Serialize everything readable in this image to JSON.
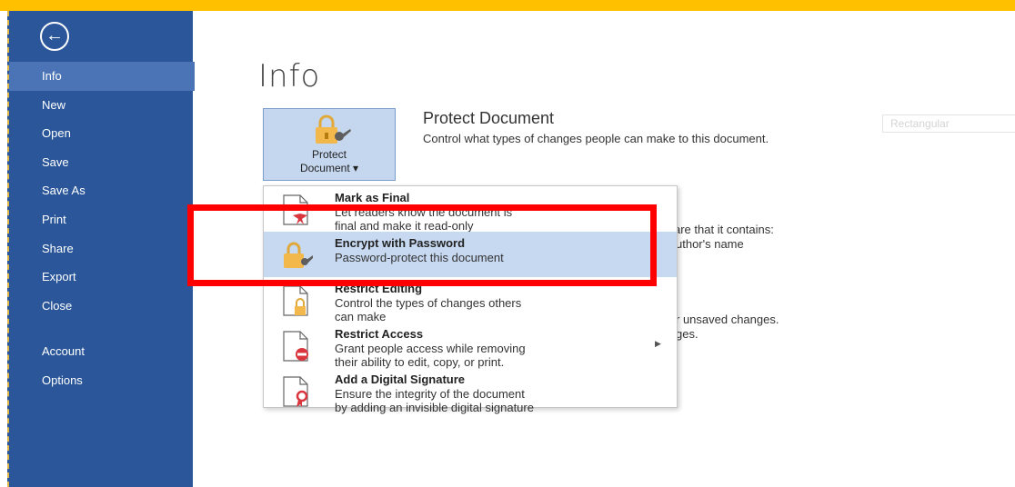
{
  "nav": {
    "back_label": "←",
    "items": [
      "Info",
      "New",
      "Open",
      "Save",
      "Save As",
      "Print",
      "Share",
      "Export",
      "Close"
    ],
    "bottom_items": [
      "Account",
      "Options"
    ]
  },
  "page": {
    "title": "Info"
  },
  "protect": {
    "button_line1": "Protect",
    "button_line2": "Document ▾",
    "section_title": "Protect Document",
    "section_desc": "Control what types of changes people can make to this document."
  },
  "ghost_box": "Rectangular",
  "background_text": {
    "t1": "are that it contains:",
    "t2": "uthor's name",
    "t3": "r unsaved changes.",
    "t4": "ges."
  },
  "menu": {
    "items": [
      {
        "title": "Mark as Final",
        "desc1": "Let readers know the document is",
        "desc2": "final and make it read-only"
      },
      {
        "title": "Encrypt with Password",
        "desc1": "Password-protect this document",
        "desc2": ""
      },
      {
        "title": "Restrict Editing",
        "desc1": "Control the types of changes others",
        "desc2": "can make"
      },
      {
        "title": "Restrict Access",
        "desc1": "Grant people access while removing",
        "desc2": "their ability to edit, copy, or print."
      },
      {
        "title": "Add a Digital Signature",
        "desc1": "Ensure the integrity of the document",
        "desc2": "by adding an invisible digital signature"
      }
    ],
    "selected_index": 1
  },
  "colors": {
    "sidebar": "#2b579a",
    "highlight_box": "#ff0000",
    "selected_item": "#c7d9f1",
    "frame_border": "#ffc000"
  }
}
